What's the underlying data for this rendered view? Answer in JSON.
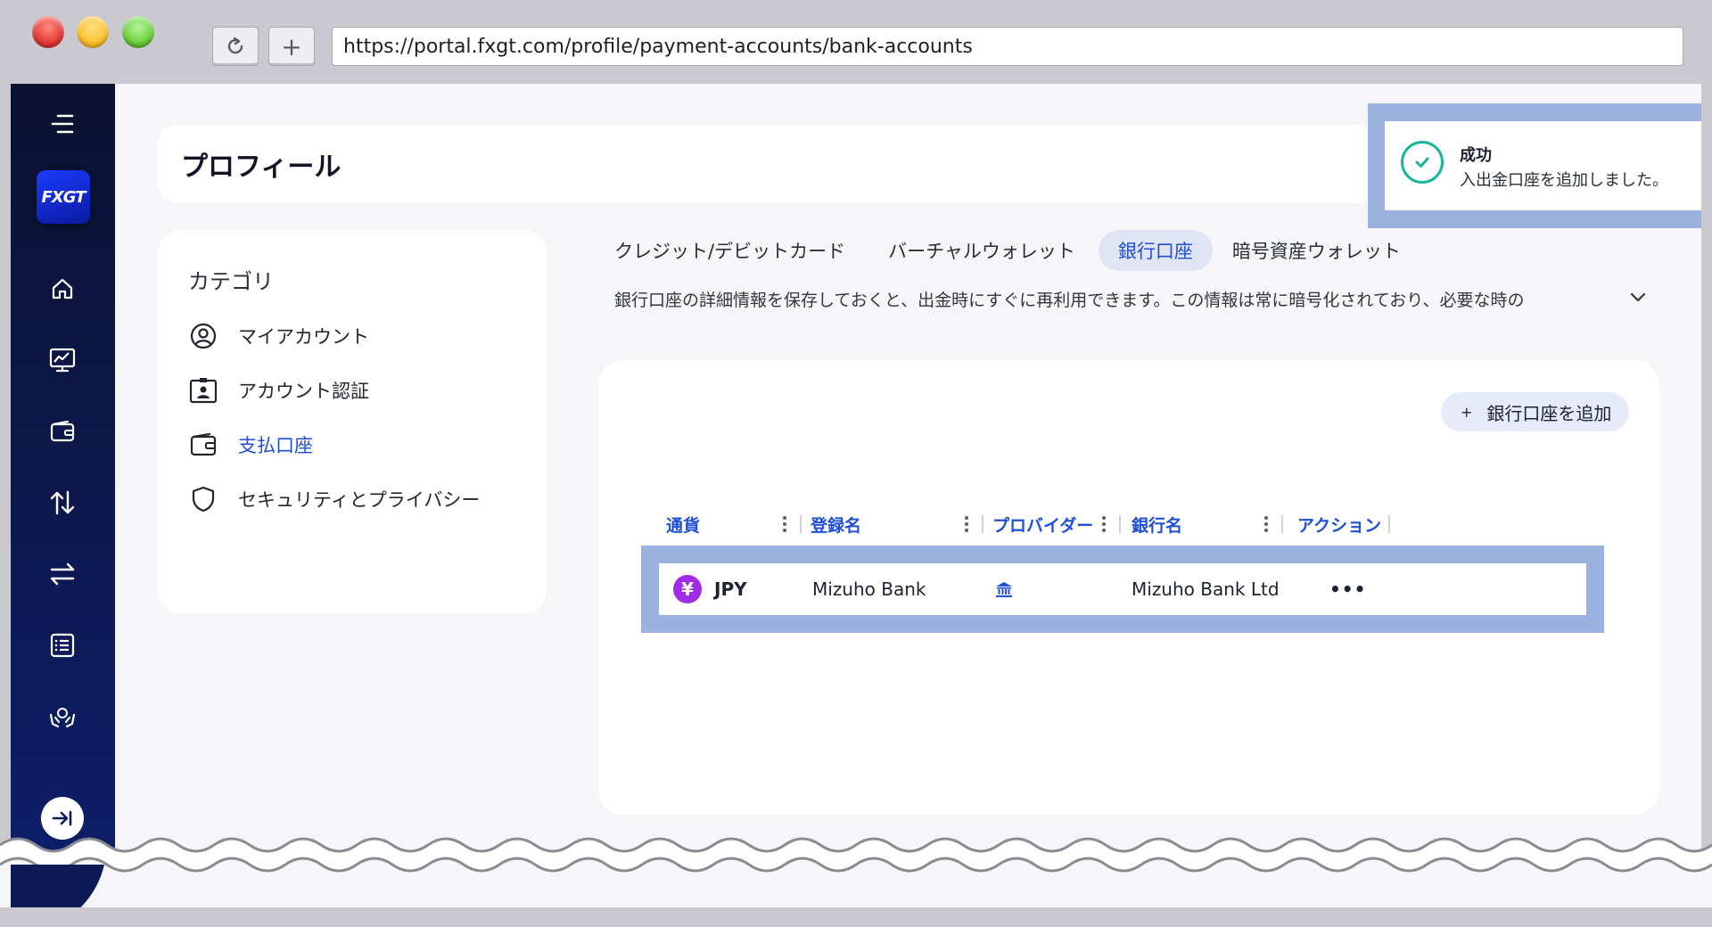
{
  "browser": {
    "url": "https://portal.fxgt.com/profile/payment-accounts/bank-accounts",
    "reload_icon": "reload-icon",
    "newtab_label": "+"
  },
  "sidebar": {
    "logo_text": "FXGT",
    "items": [
      {
        "name": "home-icon"
      },
      {
        "name": "trading-chart-icon"
      },
      {
        "name": "wallet-icon"
      },
      {
        "name": "transfer-arrows-icon"
      },
      {
        "name": "exchange-arrows-icon"
      },
      {
        "name": "list-document-icon"
      },
      {
        "name": "hands-money-icon"
      }
    ],
    "colors": {
      "bg": "#0c1a55",
      "logo": "#1c3cff"
    }
  },
  "header": {
    "title": "プロフィール"
  },
  "categories": {
    "title": "カテゴリ",
    "items": [
      {
        "label": "マイアカウント",
        "icon": "user-circle-icon",
        "active": false
      },
      {
        "label": "アカウント認証",
        "icon": "id-card-icon",
        "active": false
      },
      {
        "label": "支払口座",
        "icon": "wallet-icon",
        "active": true
      },
      {
        "label": "セキュリティとプライバシー",
        "icon": "shield-icon",
        "active": false
      }
    ]
  },
  "tabs": [
    {
      "label": "クレジット/デビットカード",
      "active": false
    },
    {
      "label": "バーチャルウォレット",
      "active": false
    },
    {
      "label": "銀行口座",
      "active": true
    },
    {
      "label": "暗号資産ウォレット",
      "active": false
    }
  ],
  "description": "銀行口座の詳細情報を保存しておくと、出金時にすぐに再利用できます。この情報は常に暗号化されており、必要な時の",
  "panel": {
    "add_button": "銀行口座を追加",
    "add_plus": "+",
    "columns": [
      "通貨",
      "登録名",
      "プロバイダー",
      "銀行名",
      "アクション"
    ],
    "rows": [
      {
        "currency": "JPY",
        "currency_symbol": "¥",
        "name": "Mizuho Bank",
        "provider_icon": "bank-icon",
        "bank": "Mizuho Bank Ltd",
        "action": "•••"
      }
    ]
  },
  "toast": {
    "title": "成功",
    "message": "入出金口座を追加しました。"
  },
  "colors": {
    "accent": "#1f4fd8",
    "highlight": "#9bb2e0",
    "success": "#17b59a",
    "error": "#d94848",
    "currency_badge": "#a02ce8"
  }
}
